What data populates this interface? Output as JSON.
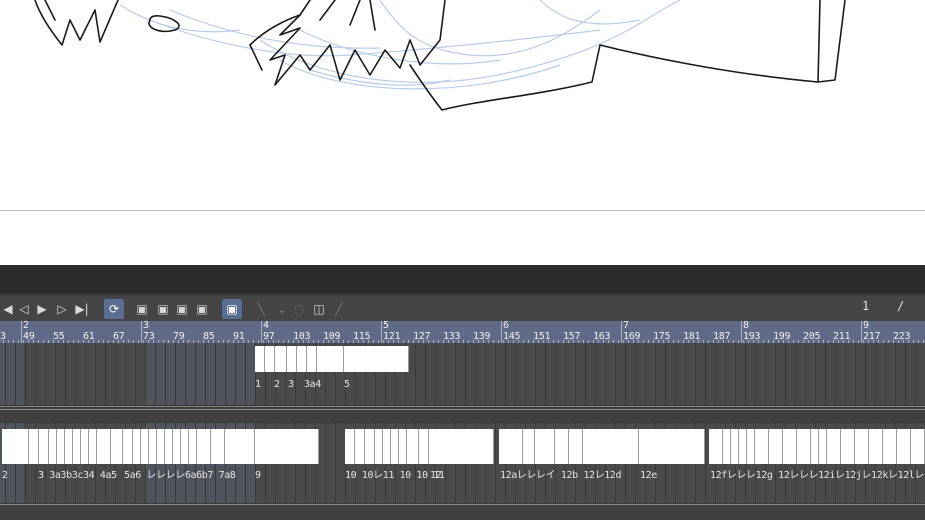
{
  "timeline": {
    "current_frame": "1",
    "frame_separator": "/",
    "toolbar": {
      "buttons": [
        {
          "name": "first-frame-icon",
          "glyph": "◀"
        },
        {
          "name": "prev-frame-icon",
          "glyph": "◁"
        },
        {
          "name": "play-icon",
          "glyph": "▶"
        },
        {
          "name": "next-frame-icon",
          "glyph": "▷"
        },
        {
          "name": "last-frame-icon",
          "glyph": "▶|"
        },
        {
          "name": "loop-icon",
          "glyph": "⟳"
        },
        {
          "name": "new-animation-cel-icon",
          "glyph": "▣"
        },
        {
          "name": "assign-cel-icon",
          "glyph": "▣"
        },
        {
          "name": "delete-cel-icon",
          "glyph": "▣"
        },
        {
          "name": "cel-spec-icon",
          "glyph": "▣"
        },
        {
          "name": "onion-skin-icon",
          "glyph": "▣"
        },
        {
          "name": "enable-onion-icon",
          "glyph": "╲"
        },
        {
          "name": "dropdown-chevron-icon",
          "glyph": "⌄"
        },
        {
          "name": "light-table-icon",
          "glyph": "◌"
        },
        {
          "name": "layer-property-icon",
          "glyph": "◫"
        },
        {
          "name": "pen-icon",
          "glyph": "╱"
        }
      ]
    },
    "ruler": {
      "seconds": [
        "2",
        "3",
        "4",
        "5",
        "6",
        "7",
        "8",
        "9"
      ],
      "frames": [
        "3",
        "49",
        "55",
        "61",
        "67",
        "73",
        "79",
        "85",
        "91",
        "97",
        "103",
        "109",
        "115",
        "121",
        "127",
        "133",
        "139",
        "145",
        "151",
        "157",
        "163",
        "169",
        "175",
        "181",
        "187",
        "193",
        "199",
        "205",
        "211",
        "217",
        "223"
      ]
    },
    "track1": {
      "labels": [
        "1",
        "2",
        "3",
        "3a4",
        "5"
      ]
    },
    "track2": {
      "labels": [
        "2",
        "3 3a3b3c34 4a5",
        "5a6 レレレレ6a6b7 7a8",
        "9",
        "10 10レ11 10 10 11",
        "12",
        "12aレレレイ 12b 12レ12d",
        "12e",
        "12fレレレ12g 12レレレ12iレ12jレ12kレ12lレ"
      ]
    }
  }
}
